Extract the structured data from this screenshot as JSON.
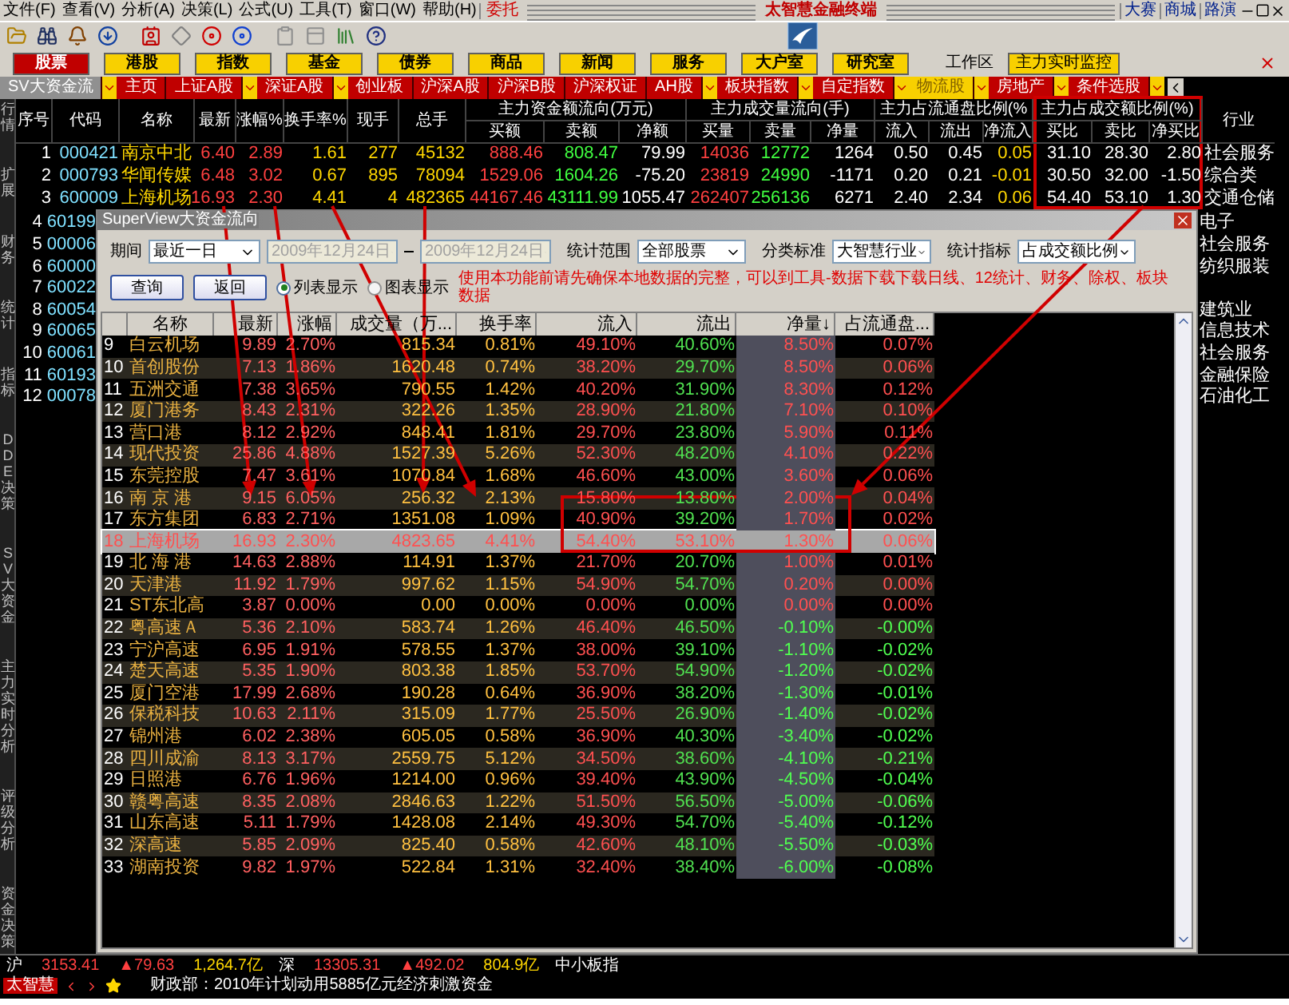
{
  "menu": [
    "文件(F)",
    "查看(V)",
    "分析(A)",
    "决策(L)",
    "公式(U)",
    "工具(T)",
    "窗口(W)",
    "帮助(H)"
  ],
  "trade_link": "委托",
  "title": "太智慧金融终端",
  "top_links": [
    "大赛",
    "商城",
    "路演"
  ],
  "nav": [
    {
      "label": "股票",
      "selected": true
    },
    {
      "label": "港股",
      "selected": false
    },
    {
      "label": "指数",
      "selected": false
    },
    {
      "label": "基金",
      "selected": false
    },
    {
      "label": "债券",
      "selected": false
    },
    {
      "label": "商品",
      "selected": false
    },
    {
      "label": "新闻",
      "selected": false
    },
    {
      "label": "服务",
      "selected": false
    },
    {
      "label": "大户室",
      "selected": false
    },
    {
      "label": "研究室",
      "selected": false
    }
  ],
  "workspace": "工作区",
  "monitor_button": "主力实时监控",
  "tabs": [
    {
      "label": "SV大资金流",
      "kind": "panel",
      "selected": false,
      "dropdown": true
    },
    {
      "label": "主页",
      "kind": "market",
      "selected": false,
      "dropdown": false
    },
    {
      "label": "上证A股",
      "kind": "market",
      "selected": false,
      "dropdown": true
    },
    {
      "label": "深证A股",
      "kind": "market",
      "selected": false,
      "dropdown": true
    },
    {
      "label": "创业板",
      "kind": "market",
      "selected": false,
      "dropdown": false
    },
    {
      "label": "沪深A股",
      "kind": "market",
      "selected": false,
      "dropdown": false
    },
    {
      "label": "沪深B股",
      "kind": "market",
      "selected": false,
      "dropdown": false
    },
    {
      "label": "沪深权证",
      "kind": "market",
      "selected": false,
      "dropdown": false
    },
    {
      "label": "AH股",
      "kind": "market",
      "selected": false,
      "dropdown": true
    },
    {
      "label": "板块指数",
      "kind": "market",
      "selected": false,
      "dropdown": true
    },
    {
      "label": "自定指数",
      "kind": "market",
      "selected": false,
      "dropdown": true
    },
    {
      "label": "物流股",
      "kind": "market",
      "selected": true,
      "dropdown": true
    },
    {
      "label": "房地产",
      "kind": "market",
      "selected": false,
      "dropdown": true
    },
    {
      "label": "条件选股",
      "kind": "market",
      "selected": false,
      "dropdown": true
    }
  ],
  "sidebar": [
    "行情",
    "扩展",
    "财务",
    "统计",
    "指标",
    "DDE决策",
    "SV大资金",
    "主力实时分析",
    "评级分析",
    "资金决策"
  ],
  "quote_table": {
    "columns": [
      "序号",
      "代码",
      "名称",
      "最新",
      "涨幅%",
      "换手率%",
      "现手",
      "总手"
    ],
    "groups": [
      {
        "label": "主力资金额流向(万元)",
        "columns": [
          "买额",
          "卖额",
          "净额"
        ]
      },
      {
        "label": "主力成交量流向(手)",
        "columns": [
          "买量",
          "卖量",
          "净量"
        ]
      },
      {
        "label": "主力占流通盘比例(%",
        "columns": [
          "流入",
          "流出",
          "净流入"
        ]
      },
      {
        "label": "主力占成交额比例(%)",
        "columns": [
          "买比",
          "卖比",
          "净买比"
        ]
      }
    ],
    "last_column": "行业",
    "rows": [
      [
        "1",
        "000421",
        "南京中北",
        "6.40",
        "2.89",
        "1.61",
        "277",
        "45132",
        "888.46",
        "808.47",
        "79.99",
        "14036",
        "12772",
        "1264",
        "0.50",
        "0.45",
        "0.05",
        "31.10",
        "28.30",
        "2.80",
        "社会服务"
      ],
      [
        "2",
        "000793",
        "华闻传媒",
        "6.48",
        "3.02",
        "0.67",
        "895",
        "78094",
        "1529.06",
        "1604.26",
        "-75.20",
        "23819",
        "24990",
        "-1171",
        "0.20",
        "0.21",
        "-0.01",
        "30.50",
        "32.00",
        "-1.50",
        "综合类"
      ],
      [
        "3",
        "600009",
        "上海机场",
        "16.93",
        "2.30",
        "4.41",
        "4",
        "482365",
        "44167.46",
        "43111.99",
        "1055.47",
        "262407",
        "256136",
        "6271",
        "2.40",
        "2.34",
        "0.06",
        "54.40",
        "53.10",
        "1.30",
        "交通仓储"
      ]
    ],
    "partial_rows": [
      {
        "seq": "4",
        "code": "60199",
        "industry": "电子"
      },
      {
        "seq": "5",
        "code": "00006",
        "industry": "社会服务"
      },
      {
        "seq": "6",
        "code": "60000",
        "industry": "纺织服装"
      },
      {
        "seq": "7",
        "code": "60022"
      },
      {
        "seq": "8",
        "code": "60054",
        "industry": "建筑业"
      },
      {
        "seq": "9",
        "code": "60065",
        "industry": "信息技术"
      },
      {
        "seq": "10",
        "code": "60061",
        "industry": "社会服务"
      },
      {
        "seq": "11",
        "code": "60193",
        "industry": "金融保险"
      },
      {
        "seq": "12",
        "code": "00078",
        "industry": "石油化工"
      }
    ]
  },
  "dialog": {
    "title": "SuperView大资金流向",
    "period_label": "期间",
    "period": "最近一日",
    "date_from": {
      "value": "2009年12月24日",
      "disabled": true
    },
    "date_to": {
      "value": "2009年12月24日",
      "disabled": true
    },
    "scope_label": "统计范围",
    "scope": "全部股票",
    "class_label": "分类标准",
    "class": "大智慧行业",
    "metric_label": "统计指标",
    "metric": "占成交额比例",
    "buttons": [
      "查询",
      "返回"
    ],
    "views": [
      {
        "label": "列表显示",
        "selected": true
      },
      {
        "label": "图表显示",
        "selected": false
      }
    ],
    "notice": "使用本功能前请先确保本地数据的完整，可以到工具-数据下载下载日线、12统计、财务、除权、板块数据",
    "columns": [
      "",
      "名称",
      "最新",
      "涨幅",
      "成交量（万...",
      "换手率",
      "流入",
      "流出",
      "净量↓",
      "占流通盘..."
    ],
    "rows": [
      {
        "cells": [
          "9",
          "白云机场",
          "9.89",
          "2.70%",
          "815.34",
          "0.81%",
          "49.10%",
          "40.60%",
          "8.50%",
          "0.07%"
        ],
        "kind": "gain",
        "selected": false
      },
      {
        "cells": [
          "10",
          "首创股份",
          "7.13",
          "1.86%",
          "1620.48",
          "0.74%",
          "38.20%",
          "29.70%",
          "8.50%",
          "0.06%"
        ],
        "kind": "gain",
        "selected": false
      },
      {
        "cells": [
          "11",
          "五洲交通",
          "7.38",
          "3.65%",
          "790.55",
          "1.42%",
          "40.20%",
          "31.90%",
          "8.30%",
          "0.12%"
        ],
        "kind": "gain",
        "selected": false
      },
      {
        "cells": [
          "12",
          "厦门港务",
          "8.43",
          "2.31%",
          "322.26",
          "1.35%",
          "28.90%",
          "21.80%",
          "7.10%",
          "0.10%"
        ],
        "kind": "gain",
        "selected": false
      },
      {
        "cells": [
          "13",
          "营口港",
          "8.12",
          "2.92%",
          "848.41",
          "1.81%",
          "29.70%",
          "23.80%",
          "5.90%",
          "0.11%"
        ],
        "kind": "gain",
        "selected": false
      },
      {
        "cells": [
          "14",
          "现代投资",
          "25.86",
          "4.88%",
          "1527.39",
          "5.26%",
          "52.30%",
          "48.20%",
          "4.10%",
          "0.22%"
        ],
        "kind": "gain",
        "selected": false
      },
      {
        "cells": [
          "15",
          "东莞控股",
          "7.47",
          "3.61%",
          "1070.84",
          "1.68%",
          "46.60%",
          "43.00%",
          "3.60%",
          "0.06%"
        ],
        "kind": "gain",
        "selected": false
      },
      {
        "cells": [
          "16",
          "南 京 港",
          "9.15",
          "6.05%",
          "256.32",
          "2.13%",
          "15.80%",
          "13.80%",
          "2.00%",
          "0.04%"
        ],
        "kind": "gain",
        "selected": false
      },
      {
        "cells": [
          "17",
          "东方集团",
          "6.83",
          "2.71%",
          "1351.08",
          "1.09%",
          "40.90%",
          "39.20%",
          "1.70%",
          "0.02%"
        ],
        "kind": "gain",
        "selected": false
      },
      {
        "cells": [
          "18",
          "上海机场",
          "16.93",
          "2.30%",
          "4823.65",
          "4.41%",
          "54.40%",
          "53.10%",
          "1.30%",
          "0.06%"
        ],
        "kind": "gain",
        "selected": true
      },
      {
        "cells": [
          "19",
          "北 海 港",
          "14.63",
          "2.88%",
          "114.91",
          "1.37%",
          "21.70%",
          "20.70%",
          "1.00%",
          "0.01%"
        ],
        "kind": "gain",
        "selected": false
      },
      {
        "cells": [
          "20",
          "天津港",
          "11.92",
          "1.79%",
          "997.62",
          "1.15%",
          "54.90%",
          "54.70%",
          "0.20%",
          "0.00%"
        ],
        "kind": "gain",
        "selected": false
      },
      {
        "cells": [
          "21",
          "ST东北高",
          "3.87",
          "0.00%",
          "0.00",
          "0.00%",
          "0.00%",
          "0.00%",
          "0.00%",
          "0.00%"
        ],
        "kind": "gain",
        "selected": false
      },
      {
        "cells": [
          "22",
          "粤高速Ａ",
          "5.36",
          "2.10%",
          "583.74",
          "1.26%",
          "46.40%",
          "46.50%",
          "-0.10%",
          "-0.00%"
        ],
        "kind": "loss",
        "selected": false
      },
      {
        "cells": [
          "23",
          "宁沪高速",
          "6.95",
          "1.91%",
          "578.55",
          "1.37%",
          "38.00%",
          "39.10%",
          "-1.10%",
          "-0.02%"
        ],
        "kind": "loss",
        "selected": false
      },
      {
        "cells": [
          "24",
          "楚天高速",
          "5.35",
          "1.90%",
          "803.38",
          "1.85%",
          "53.70%",
          "54.90%",
          "-1.20%",
          "-0.02%"
        ],
        "kind": "loss",
        "selected": false
      },
      {
        "cells": [
          "25",
          "厦门空港",
          "17.99",
          "2.68%",
          "190.28",
          "0.64%",
          "36.90%",
          "38.20%",
          "-1.30%",
          "-0.01%"
        ],
        "kind": "loss",
        "selected": false
      },
      {
        "cells": [
          "26",
          "保税科技",
          "10.63",
          "2.11%",
          "315.09",
          "1.77%",
          "25.50%",
          "26.90%",
          "-1.40%",
          "-0.02%"
        ],
        "kind": "loss",
        "selected": false
      },
      {
        "cells": [
          "27",
          "锦州港",
          "6.02",
          "2.38%",
          "605.05",
          "0.58%",
          "36.90%",
          "40.30%",
          "-3.40%",
          "-0.02%"
        ],
        "kind": "loss",
        "selected": false
      },
      {
        "cells": [
          "28",
          "四川成渝",
          "8.13",
          "3.17%",
          "2559.75",
          "5.12%",
          "34.50%",
          "38.60%",
          "-4.10%",
          "-0.21%"
        ],
        "kind": "loss",
        "selected": false
      },
      {
        "cells": [
          "29",
          "日照港",
          "6.76",
          "1.96%",
          "1214.00",
          "0.96%",
          "39.40%",
          "43.90%",
          "-4.50%",
          "-0.04%"
        ],
        "kind": "loss",
        "selected": false
      },
      {
        "cells": [
          "30",
          "赣粤高速",
          "8.35",
          "2.08%",
          "2846.63",
          "1.22%",
          "51.50%",
          "56.50%",
          "-5.00%",
          "-0.06%"
        ],
        "kind": "loss",
        "selected": false
      },
      {
        "cells": [
          "31",
          "山东高速",
          "5.11",
          "1.79%",
          "1428.08",
          "2.14%",
          "49.30%",
          "54.70%",
          "-5.40%",
          "-0.12%"
        ],
        "kind": "loss",
        "selected": false
      },
      {
        "cells": [
          "32",
          "深高速",
          "5.85",
          "2.09%",
          "825.40",
          "0.58%",
          "42.60%",
          "48.10%",
          "-5.50%",
          "-0.03%"
        ],
        "kind": "loss",
        "selected": false
      },
      {
        "cells": [
          "33",
          "湖南投资",
          "9.82",
          "1.97%",
          "522.84",
          "1.31%",
          "32.40%",
          "38.40%",
          "-6.00%",
          "-0.08%"
        ],
        "kind": "loss",
        "selected": false
      }
    ]
  },
  "status": {
    "markets": [
      {
        "label": "沪",
        "index": "3153.41",
        "change": "▲79.63",
        "amount": "1,264.7亿"
      },
      {
        "label": "深",
        "index": "13305.31",
        "change": "▲492.02",
        "amount": "804.9亿"
      }
    ],
    "next_index": "中小板指",
    "logo": "太智慧",
    "news": "财政部：2010年计划动用5885亿元经济刺激资金"
  }
}
